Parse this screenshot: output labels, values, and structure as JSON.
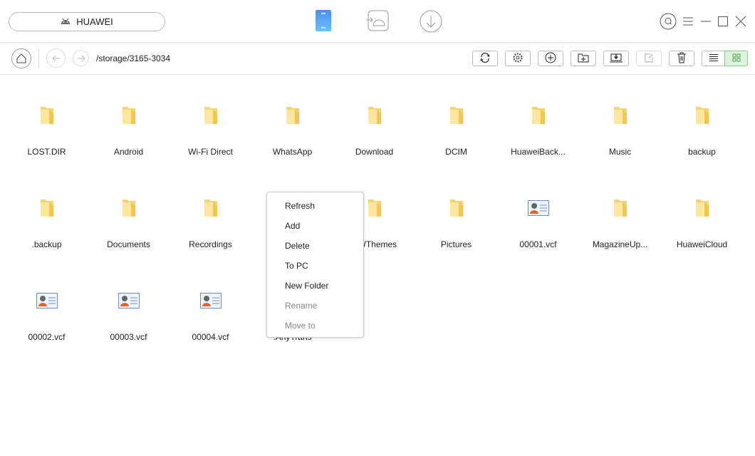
{
  "header": {
    "device_name": "HUAWEI",
    "device_icon": "android-icon",
    "nav_icons": [
      "phone-icon",
      "android-transfer-icon",
      "download-icon"
    ],
    "accent": "#4a90f0"
  },
  "window_controls": [
    "search-icon",
    "menu-icon",
    "minimize-icon",
    "maximize-icon",
    "close-icon"
  ],
  "navbar": {
    "path": "/storage/3165-3034"
  },
  "toolbar": [
    "refresh-icon",
    "settings-icon",
    "add-icon",
    "new-folder-icon",
    "to-pc-icon",
    "edit-icon",
    "delete-icon",
    "list-view-icon",
    "grid-view-icon"
  ],
  "view_active": "grid",
  "active_color": "#dff0df",
  "files": [
    {
      "name": "LOST.DIR",
      "type": "folder"
    },
    {
      "name": "Android",
      "type": "folder"
    },
    {
      "name": "Wi-Fi Direct",
      "type": "folder"
    },
    {
      "name": "WhatsApp",
      "type": "folder"
    },
    {
      "name": "Download",
      "type": "folder"
    },
    {
      "name": "DCIM",
      "type": "folder"
    },
    {
      "name": "HuaweiBack...",
      "type": "folder"
    },
    {
      "name": "Music",
      "type": "folder"
    },
    {
      "name": "backup",
      "type": "folder"
    },
    {
      "name": ".backup",
      "type": "folder"
    },
    {
      "name": "Documents",
      "type": "folder"
    },
    {
      "name": "Recordings",
      "type": "folder"
    },
    {
      "name": "",
      "type": "folder"
    },
    {
      "name": "HWThemes",
      "type": "folder"
    },
    {
      "name": "Pictures",
      "type": "folder"
    },
    {
      "name": "00001.vcf",
      "type": "vcf"
    },
    {
      "name": "MagazineUp...",
      "type": "folder"
    },
    {
      "name": "HuaweiCloud",
      "type": "folder"
    },
    {
      "name": "00002.vcf",
      "type": "vcf"
    },
    {
      "name": "00003.vcf",
      "type": "vcf"
    },
    {
      "name": "00004.vcf",
      "type": "vcf"
    },
    {
      "name": ".AnyTrans",
      "type": "folder"
    }
  ],
  "context_menu": [
    {
      "label": "Refresh",
      "enabled": true
    },
    {
      "label": "Add",
      "enabled": true
    },
    {
      "label": "Delete",
      "enabled": true
    },
    {
      "label": "To PC",
      "enabled": true
    },
    {
      "label": "New Folder",
      "enabled": true
    },
    {
      "label": "Rename",
      "enabled": false
    },
    {
      "label": "Move to",
      "enabled": false
    }
  ]
}
